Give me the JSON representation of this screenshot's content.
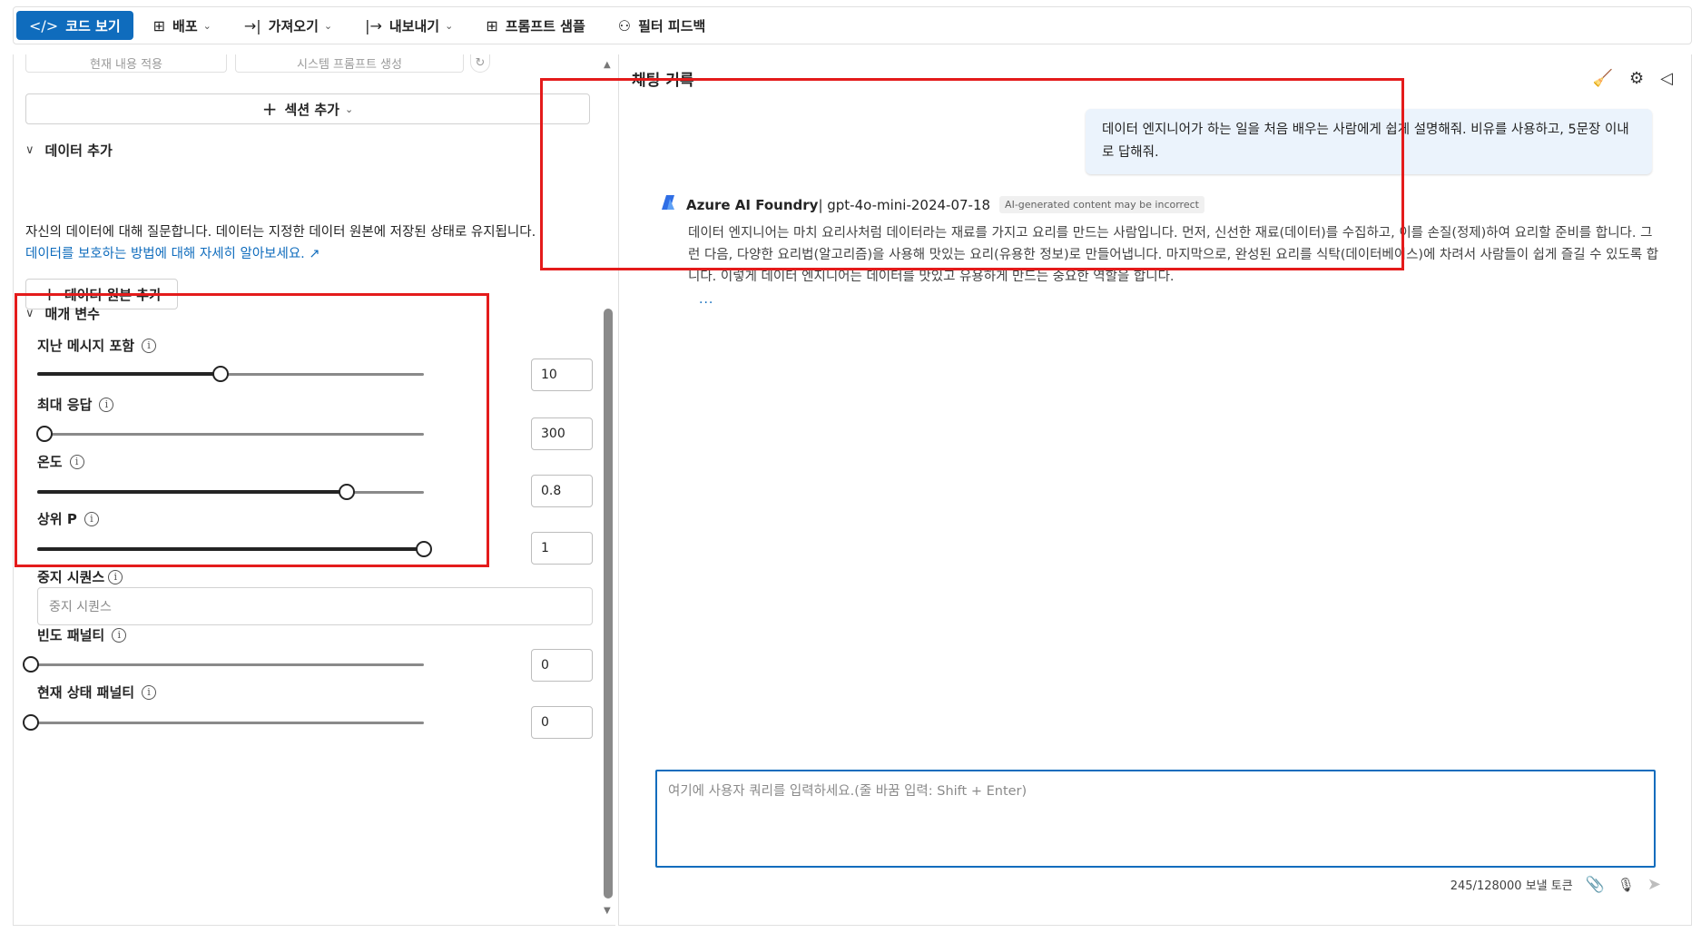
{
  "toolbar": {
    "code": "코드 보기",
    "deploy": "배포",
    "import": "가져오기",
    "export": "내보내기",
    "samples": "프롬프트 샘플",
    "feedback": "필터 피드백"
  },
  "left": {
    "ghost_apply": "현재 내용 적용",
    "ghost_generate": "시스템 프롬프트 생성",
    "add_section": "섹션 추가",
    "data_header": "데이터 추가",
    "data_desc": "자신의 데이터에 대해 질문합니다. 데이터는 지정한 데이터 원본에 저장된 상태로 유지됩니다.",
    "data_link": "데이터를 보호하는 방법에 대해 자세히 알아보세요.",
    "add_source": "데이터 원본 추가",
    "params_header": "매개 변수",
    "params": [
      {
        "label": "지난 메시지 포함",
        "value": "10",
        "fraction": 0.475
      },
      {
        "label": "최대 응답",
        "value": "300",
        "fraction": 0.018
      },
      {
        "label": "온도",
        "value": "0.8",
        "fraction": 0.8
      },
      {
        "label": "상위 P",
        "value": "1",
        "fraction": 1.0
      }
    ],
    "stop_label": "중지 시퀀스",
    "stop_placeholder": "중지 시퀀스",
    "freq_label": "빈도 패널티",
    "freq_value": "0",
    "freq_fraction": 0.0,
    "presence_label": "현재 상태 패널티",
    "presence_value": "0",
    "presence_fraction": 0.0
  },
  "chat": {
    "title": "채팅 기록",
    "user_message": "데이터 엔지니어가 하는 일을 처음 배우는 사람에게 쉽게 설명해줘. 비유를 사용하고, 5문장 이내로 답해줘.",
    "bot_name": "Azure AI Foundry",
    "bot_model": " | gpt-4o-mini-2024-07-18",
    "ai_badge": "AI-generated content may be incorrect",
    "bot_message": "데이터 엔지니어는 마치 요리사처럼 데이터라는 재료를 가지고 요리를 만드는 사람입니다. 먼저, 신선한 재료(데이터)를 수집하고, 이를 손질(정제)하여 요리할 준비를 합니다. 그런 다음, 다양한 요리법(알고리즘)을 사용해 맛있는 요리(유용한 정보)로 만들어냅니다. 마지막으로, 완성된 요리를 식탁(데이터베이스)에 차려서 사람들이 쉽게 즐길 수 있도록 합니다. 이렇게 데이터 엔지니어는 데이터를 맛있고 유용하게 만드는 중요한 역할을 합니다.",
    "dots": "...",
    "query_placeholder": "여기에 사용자 쿼리를 입력하세요.(줄 바꿈 입력: Shift + Enter)",
    "token_count": "245/128000 보낼 토큰"
  },
  "colors": {
    "accent": "#0f6cbd",
    "highlight": "#e41b1b"
  }
}
